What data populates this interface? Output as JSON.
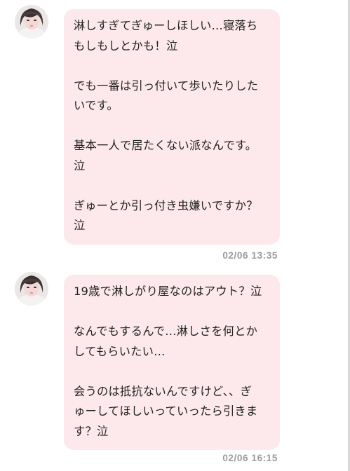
{
  "messages": [
    {
      "avatar_icon": "user-avatar-photo",
      "paragraphs": [
        "淋しすぎてぎゅーしほしい…寝落ち\nもしもしとかも！泣",
        "でも一番は引っ付いて歩いたりした\nいです。",
        "基本一人で居たくない派なんです。\n泣",
        "ぎゅーとか引っ付き虫嫌いですか？\n泣"
      ],
      "timestamp": "02/06 13:35"
    },
    {
      "avatar_icon": "user-avatar-photo",
      "paragraphs": [
        "19歳で淋しがり屋なのはアウト？泣",
        "なんでもするんで…淋しさを何とか\nしてもらいたい…",
        "会うのは抵抗ないんですけど、、ぎ\nゅーしてほしいっていったら引きま\nす？泣"
      ],
      "timestamp": "02/06 16:15"
    }
  ],
  "colors": {
    "bubble_background": "#fde9ec",
    "message_text": "#222222",
    "timestamp_text": "#9a9a9a"
  }
}
